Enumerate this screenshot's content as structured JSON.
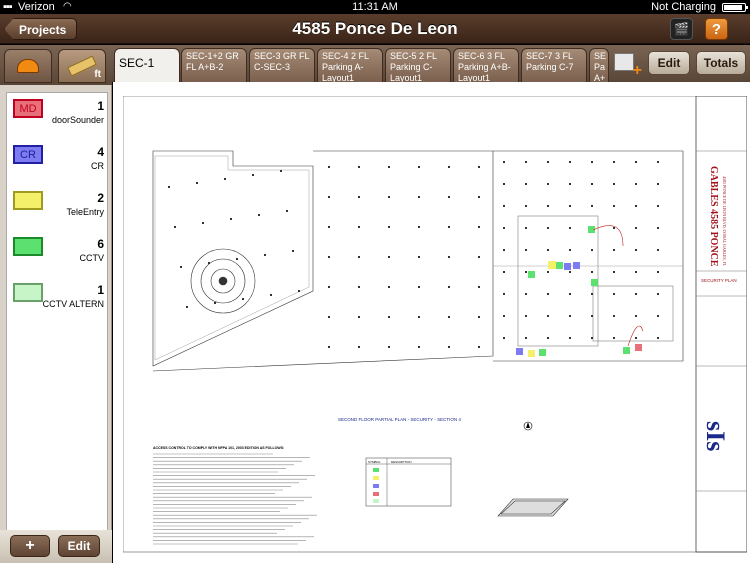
{
  "status": {
    "carrier": "Verizon",
    "time": "11:31 AM",
    "battery": "Not Charging"
  },
  "nav": {
    "back_label": "Projects",
    "title": "4585 Ponce De Leon"
  },
  "left_tabs": {
    "ruler_unit": "ft"
  },
  "symbols": [
    {
      "code": "MD",
      "count": "1",
      "name": "doorSounder",
      "color": "#e8707a",
      "border": "#c00020"
    },
    {
      "code": "CR",
      "count": "4",
      "name": "CR",
      "color": "#7c7cf0",
      "border": "#2020a0"
    },
    {
      "code": "",
      "count": "2",
      "name": "TeleEntry",
      "color": "#f5f06a",
      "border": "#a09a20"
    },
    {
      "code": "",
      "count": "6",
      "name": "CCTV",
      "color": "#5ce070",
      "border": "#1a8a2a"
    },
    {
      "code": "",
      "count": "1",
      "name": "CCTV ALTERN",
      "color": "#c8f5c8",
      "border": "#6aa06a"
    }
  ],
  "left_bottom": {
    "add_label": "+",
    "edit_label": "Edit"
  },
  "sheet_tabs": [
    "SEC-1",
    "SEC-1+2 GR FL A+B-2",
    "SEC-3 GR FL C-SEC-3",
    "SEC-4 2 FL Parking A-Layout1",
    "SEC-5 2 FL Parking C-Layout1",
    "SEC-6 3 FL Parking A+B-Layout1",
    "SEC-7 3 FL Parking C-7",
    "SE Pa A+"
  ],
  "toolbar": {
    "edit_label": "Edit",
    "totals_label": "Totals"
  },
  "drawing": {
    "title_block_name": "GABLES 4585 PONCE",
    "title_block_address": "4585 PONCE DE LEON BLVD. CORAL GABLES, FL",
    "sheet_title": "SECURITY PLAN",
    "company_logo": "sIs",
    "plan_caption": "SECOND FLOOR PARTIAL PLAN - SECURITY - SECTION 4",
    "legend_header_1": "SYMBOL",
    "legend_header_2": "DESCRIPTION",
    "notes_heading": "ACCESS CONTROL TO COMPLY WITH NFPA 101, 2003 EDITION AS FOLLOWS:"
  }
}
